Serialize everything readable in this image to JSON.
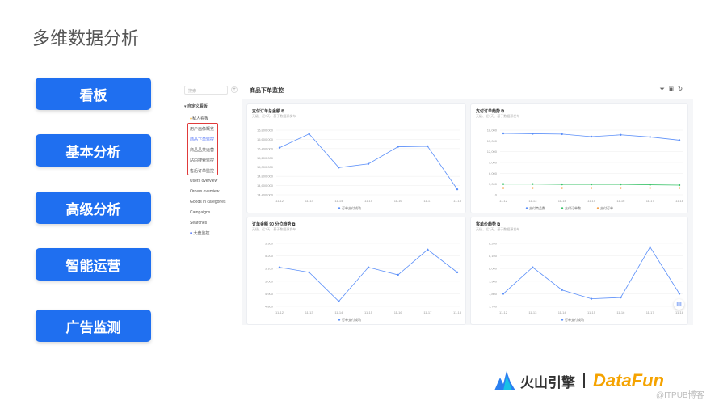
{
  "slide": {
    "title": "多维数据分析",
    "nav": [
      "看板",
      "基本分析",
      "高级分析",
      "智能运营",
      "广告监测"
    ]
  },
  "sidebar": {
    "search_placeholder": "搜索",
    "group": "自定义看板",
    "private": "私人看板",
    "items": [
      "用户画像概览",
      "商品下单监控",
      "商品品类运营",
      "站内搜索监控",
      "售后订单监控",
      "Users overview",
      "Orders overview",
      "Goods in categories",
      "Campaigns",
      "Searches"
    ],
    "folder": "大盘监控",
    "active_index": 1
  },
  "header": {
    "title": "商品下单监控",
    "icons": [
      "filter-icon",
      "calendar-icon",
      "refresh-icon"
    ]
  },
  "colors": {
    "accent": "#1f6ff0",
    "blue": "#5b8ff9",
    "green": "#3cc36a",
    "orange": "#f5a04a",
    "red": "#e03a3a"
  },
  "footer": {
    "brand": "火山引擎",
    "partner": "DataFun",
    "watermark": "@ITPUB博客"
  },
  "chart_data": [
    {
      "type": "line",
      "title": "支付订单总金额",
      "subtitle": "天级、近7天、基于数据源发布",
      "categories": [
        "11-12",
        "11-13",
        "11-14",
        "11-15",
        "11-16",
        "11-17",
        "11-18"
      ],
      "ylim": [
        14400000,
        15800000
      ],
      "yticks": [
        "15,800,000",
        "15,600,000",
        "15,400,000",
        "15,200,000",
        "15,000,000",
        "14,800,000",
        "14,600,000",
        "14,400,000"
      ],
      "series": [
        {
          "name": "订单支付成功",
          "color": "#5b8ff9",
          "values": [
            15420000,
            15720000,
            14990000,
            15070000,
            15440000,
            15450000,
            14520000
          ]
        }
      ]
    },
    {
      "type": "line",
      "title": "支付订单趋势",
      "subtitle": "天级、近7天、基于数据源发布",
      "categories": [
        "11-12",
        "11-13",
        "11-14",
        "11-15",
        "11-16",
        "11-17",
        "11-18"
      ],
      "ylim": [
        0,
        18000
      ],
      "yticks": [
        "18,000",
        "15,000",
        "12,000",
        "9,000",
        "6,000",
        "3,000",
        "0"
      ],
      "series": [
        {
          "name": "支付商品数",
          "color": "#5b8ff9",
          "values": [
            17100,
            17000,
            16900,
            16200,
            16700,
            16100,
            15200
          ]
        },
        {
          "name": "支付订单数",
          "color": "#3cc36a",
          "values": [
            3000,
            3000,
            2900,
            2900,
            2900,
            2800,
            2700
          ]
        },
        {
          "name": "支付订单...",
          "color": "#f5a04a",
          "values": [
            1900,
            1900,
            1900,
            1900,
            1900,
            1900,
            1900
          ]
        }
      ]
    },
    {
      "type": "line",
      "title": "订单金额 90 分位趋势",
      "subtitle": "天级、近7天、基于数据源发布",
      "categories": [
        "11-12",
        "11-13",
        "11-14",
        "11-15",
        "11-16",
        "11-17",
        "11-18"
      ],
      "ylim": [
        4800,
        5300
      ],
      "yticks": [
        "5,300",
        "5,200",
        "5,100",
        "5,000",
        "4,900",
        "4,800"
      ],
      "series": [
        {
          "name": "订单支付成功",
          "color": "#5b8ff9",
          "values": [
            5110,
            5070,
            4840,
            5110,
            5050,
            5250,
            5070
          ]
        }
      ]
    },
    {
      "type": "line",
      "title": "客单价趋势",
      "subtitle": "天级、近7天、基于数据源发布",
      "categories": [
        "11-12",
        "11-13",
        "11-14",
        "11-15",
        "11-16",
        "11-17",
        "11-18"
      ],
      "ylim": [
        7700,
        8200
      ],
      "yticks": [
        "8,200",
        "8,100",
        "8,000",
        "7,900",
        "7,800",
        "7,700"
      ],
      "series": [
        {
          "name": "订单支付成功",
          "color": "#5b8ff9",
          "values": [
            7800,
            8010,
            7830,
            7760,
            7770,
            8170,
            7800
          ]
        }
      ]
    }
  ]
}
